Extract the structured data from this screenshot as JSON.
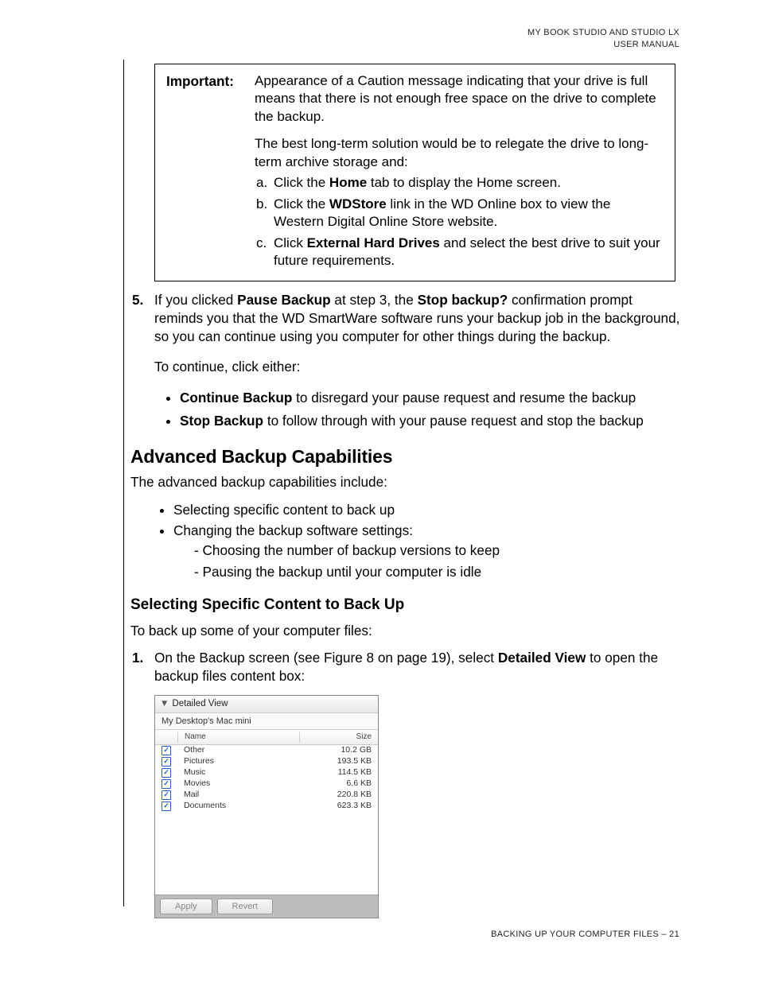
{
  "header": {
    "line1": "MY BOOK STUDIO AND  STUDIO LX",
    "line2": "USER MANUAL"
  },
  "important": {
    "label": "Important:",
    "p1": "Appearance of a Caution message indicating that your drive is full means that there is not enough free space on the drive to complete the backup.",
    "p2": "The best long-term solution would be to relegate the drive to long-term archive storage and:",
    "a_pre": "Click the ",
    "a_bold": "Home",
    "a_post": " tab to display the Home screen.",
    "b_pre": "Click the ",
    "b_bold": "WDStore",
    "b_post": " link in the WD Online box to view the Western Digital Online Store website.",
    "c_pre": "Click ",
    "c_bold": "External Hard Drives",
    "c_post": " and select the best drive to suit your future requirements."
  },
  "step5": {
    "num": "5.",
    "para_pre": "If you clicked ",
    "para_b1": "Pause Backup",
    "para_mid1": " at step 3, the ",
    "para_b2": "Stop backup?",
    "para_post": " confirmation prompt reminds you that the WD SmartWare software runs your backup job in the background, so you can continue using you computer for other things during the backup.",
    "continue_line": "To continue, click either:",
    "bullet1_b": "Continue Backup",
    "bullet1_t": " to disregard your pause request and resume the backup",
    "bullet2_b": "Stop Backup",
    "bullet2_t": " to follow through with your pause request and stop the backup"
  },
  "adv": {
    "heading": "Advanced Backup Capabilities",
    "intro": "The advanced backup capabilities include:",
    "b1": "Selecting specific content to back up",
    "b2": "Changing the backup software settings:",
    "b2a": "Choosing the number of backup versions to keep",
    "b2b": "Pausing the backup until your computer is idle"
  },
  "sel": {
    "heading": "Selecting Specific Content to Back Up",
    "intro": "To back up some of your computer files:",
    "num": "1.",
    "para_pre": "On the Backup screen (see Figure 8 on page 19), select ",
    "para_b": "Detailed View",
    "para_post": " to open the backup files content box:"
  },
  "shot": {
    "title": "Detailed View",
    "subtitle": "My Desktop's Mac mini",
    "col_name": "Name",
    "col_size": "Size",
    "rows": [
      {
        "name": "Other",
        "size": "10.2 GB"
      },
      {
        "name": "Pictures",
        "size": "193.5 KB"
      },
      {
        "name": "Music",
        "size": "114.5 KB"
      },
      {
        "name": "Movies",
        "size": "6.6 KB"
      },
      {
        "name": "Mail",
        "size": "220.8 KB"
      },
      {
        "name": "Documents",
        "size": "623.3 KB"
      }
    ],
    "apply": "Apply",
    "revert": "Revert"
  },
  "footer": {
    "text": "BACKING UP YOUR COMPUTER FILES – 21"
  }
}
